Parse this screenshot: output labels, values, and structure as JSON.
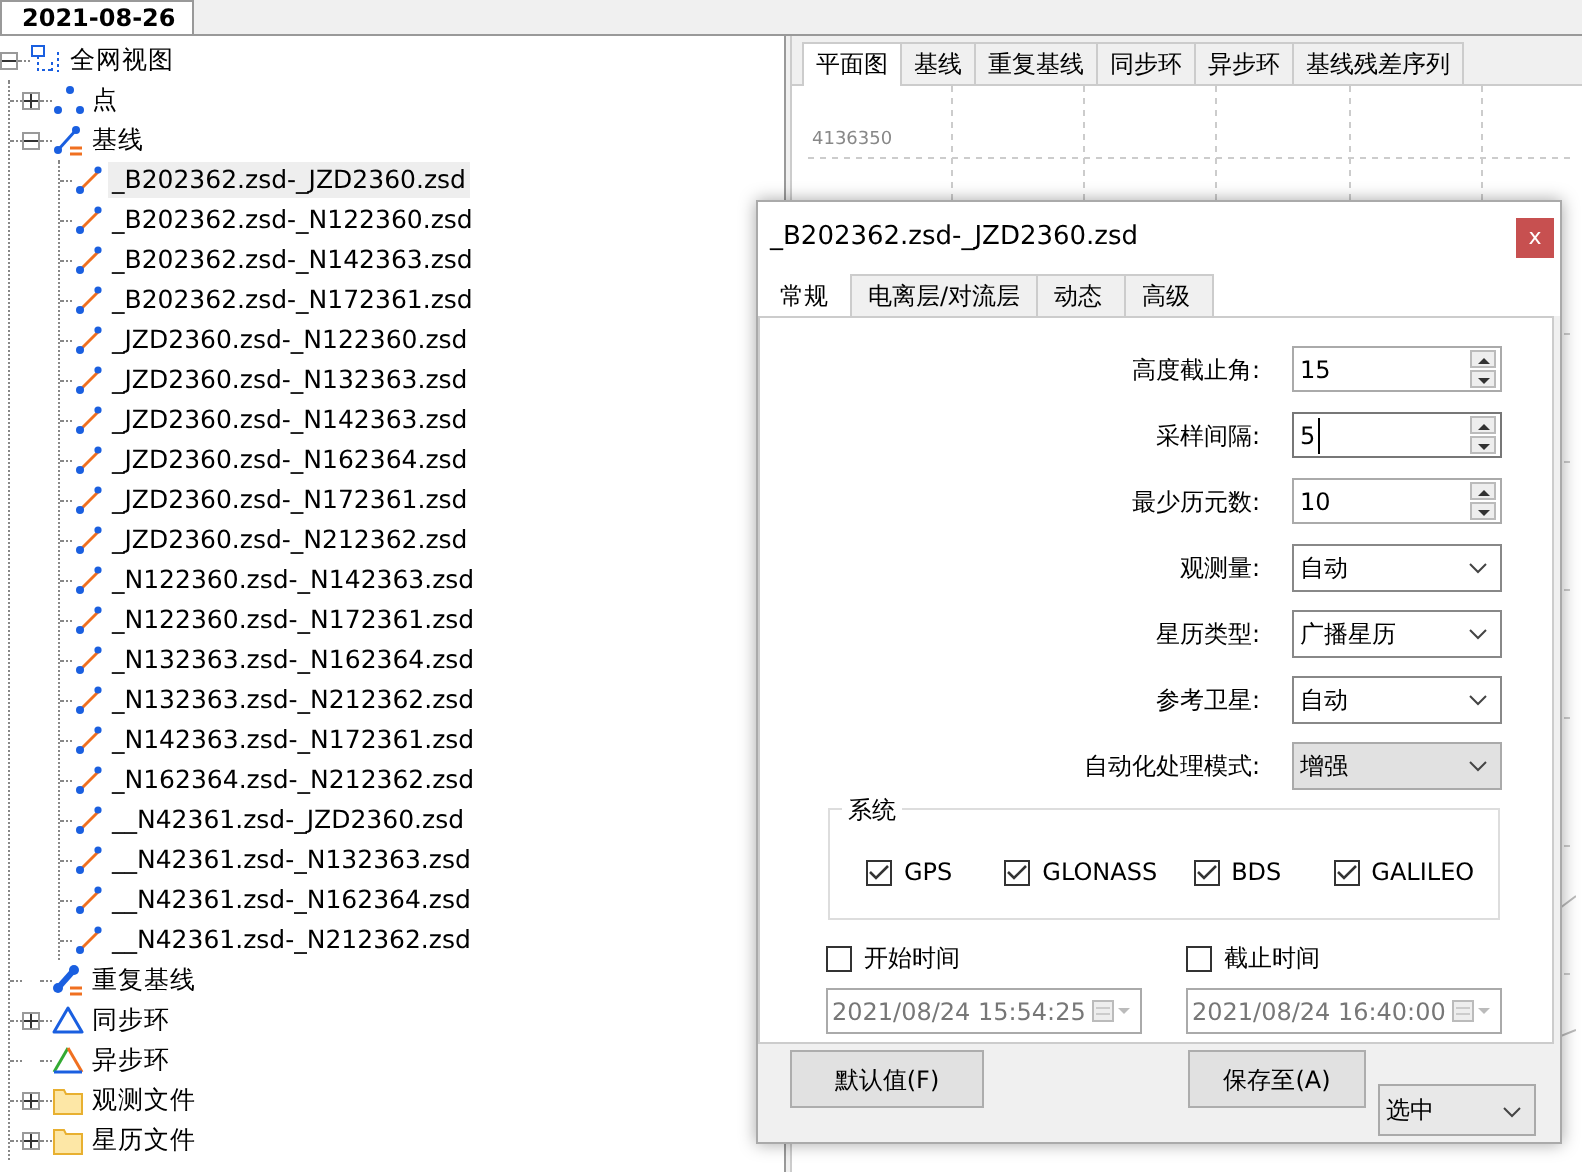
{
  "document_tabs": [
    {
      "label": "2021-08-26",
      "selected": true
    }
  ],
  "tree": {
    "label": "全网视图",
    "kind": "network",
    "expanded": true,
    "selected": false,
    "children": [
      {
        "label": "点",
        "kind": "points",
        "expanded": false,
        "selected": false
      },
      {
        "label": "基线",
        "kind": "baselines",
        "expanded": true,
        "selected": false,
        "children": [
          {
            "label": "_B202362.zsd-_JZD2360.zsd",
            "kind": "baseline",
            "selected": true
          },
          {
            "label": "_B202362.zsd-_N122360.zsd",
            "kind": "baseline",
            "selected": false
          },
          {
            "label": "_B202362.zsd-_N142363.zsd",
            "kind": "baseline",
            "selected": false
          },
          {
            "label": "_B202362.zsd-_N172361.zsd",
            "kind": "baseline",
            "selected": false
          },
          {
            "label": "_JZD2360.zsd-_N122360.zsd",
            "kind": "baseline",
            "selected": false
          },
          {
            "label": "_JZD2360.zsd-_N132363.zsd",
            "kind": "baseline",
            "selected": false
          },
          {
            "label": "_JZD2360.zsd-_N142363.zsd",
            "kind": "baseline",
            "selected": false
          },
          {
            "label": "_JZD2360.zsd-_N162364.zsd",
            "kind": "baseline",
            "selected": false
          },
          {
            "label": "_JZD2360.zsd-_N172361.zsd",
            "kind": "baseline",
            "selected": false
          },
          {
            "label": "_JZD2360.zsd-_N212362.zsd",
            "kind": "baseline",
            "selected": false
          },
          {
            "label": "_N122360.zsd-_N142363.zsd",
            "kind": "baseline",
            "selected": false
          },
          {
            "label": "_N122360.zsd-_N172361.zsd",
            "kind": "baseline",
            "selected": false
          },
          {
            "label": "_N132363.zsd-_N162364.zsd",
            "kind": "baseline",
            "selected": false
          },
          {
            "label": "_N132363.zsd-_N212362.zsd",
            "kind": "baseline",
            "selected": false
          },
          {
            "label": "_N142363.zsd-_N172361.zsd",
            "kind": "baseline",
            "selected": false
          },
          {
            "label": "_N162364.zsd-_N212362.zsd",
            "kind": "baseline",
            "selected": false
          },
          {
            "label": "__N42361.zsd-_JZD2360.zsd",
            "kind": "baseline",
            "selected": false
          },
          {
            "label": "__N42361.zsd-_N132363.zsd",
            "kind": "baseline",
            "selected": false
          },
          {
            "label": "__N42361.zsd-_N162364.zsd",
            "kind": "baseline",
            "selected": false
          },
          {
            "label": "__N42361.zsd-_N212362.zsd",
            "kind": "baseline",
            "selected": false
          }
        ]
      },
      {
        "label": "重复基线",
        "kind": "repeat",
        "selected": false
      },
      {
        "label": "同步环",
        "kind": "sync-loop",
        "expanded": false,
        "selected": false
      },
      {
        "label": "异步环",
        "kind": "async-loop",
        "selected": false
      },
      {
        "label": "观测文件",
        "kind": "folder",
        "expanded": false,
        "selected": false
      },
      {
        "label": "星历文件",
        "kind": "folder",
        "expanded": false,
        "selected": false
      }
    ]
  },
  "view_tabs": [
    {
      "label": "平面图",
      "selected": true
    },
    {
      "label": "基线",
      "selected": false
    },
    {
      "label": "重复基线",
      "selected": false
    },
    {
      "label": "同步环",
      "selected": false
    },
    {
      "label": "异步环",
      "selected": false
    },
    {
      "label": "基线残差序列",
      "selected": false
    }
  ],
  "plot": {
    "y_tick_label": "4136350"
  },
  "dialog": {
    "title": "_B202362.zsd-_JZD2360.zsd",
    "close": "x",
    "tabs": [
      {
        "label": "常规",
        "selected": true
      },
      {
        "label": "电离层/对流层",
        "selected": false
      },
      {
        "label": "动态",
        "selected": false
      },
      {
        "label": "高级",
        "selected": false
      }
    ],
    "fields": [
      {
        "label": "高度截止角:",
        "kind": "spin",
        "value": "15",
        "focused": false
      },
      {
        "label": "采样间隔:",
        "kind": "spin",
        "value": "5",
        "focused": true
      },
      {
        "label": "最少历元数:",
        "kind": "spin",
        "value": "10",
        "focused": false
      },
      {
        "label": "观测量:",
        "kind": "dropdown",
        "value": "自动"
      },
      {
        "label": "星历类型:",
        "kind": "dropdown",
        "value": "广播星历"
      },
      {
        "label": "参考卫星:",
        "kind": "dropdown",
        "value": "自动"
      },
      {
        "label": "自动化处理模式:",
        "kind": "list",
        "value": "增强"
      }
    ],
    "systems": {
      "title": "系统",
      "items": [
        {
          "label": "GPS",
          "checked": true
        },
        {
          "label": "GLONASS",
          "checked": true
        },
        {
          "label": "BDS",
          "checked": true
        },
        {
          "label": "GALILEO",
          "checked": true
        }
      ]
    },
    "times": [
      {
        "label": "开始时间",
        "checked": false,
        "value": "2021/08/24 15:54:25"
      },
      {
        "label": "截止时间",
        "checked": false,
        "value": "2021/08/24 16:40:00"
      }
    ],
    "default_button": "默认值(F)",
    "save_button": "保存至(A)",
    "save_target": "选中"
  }
}
